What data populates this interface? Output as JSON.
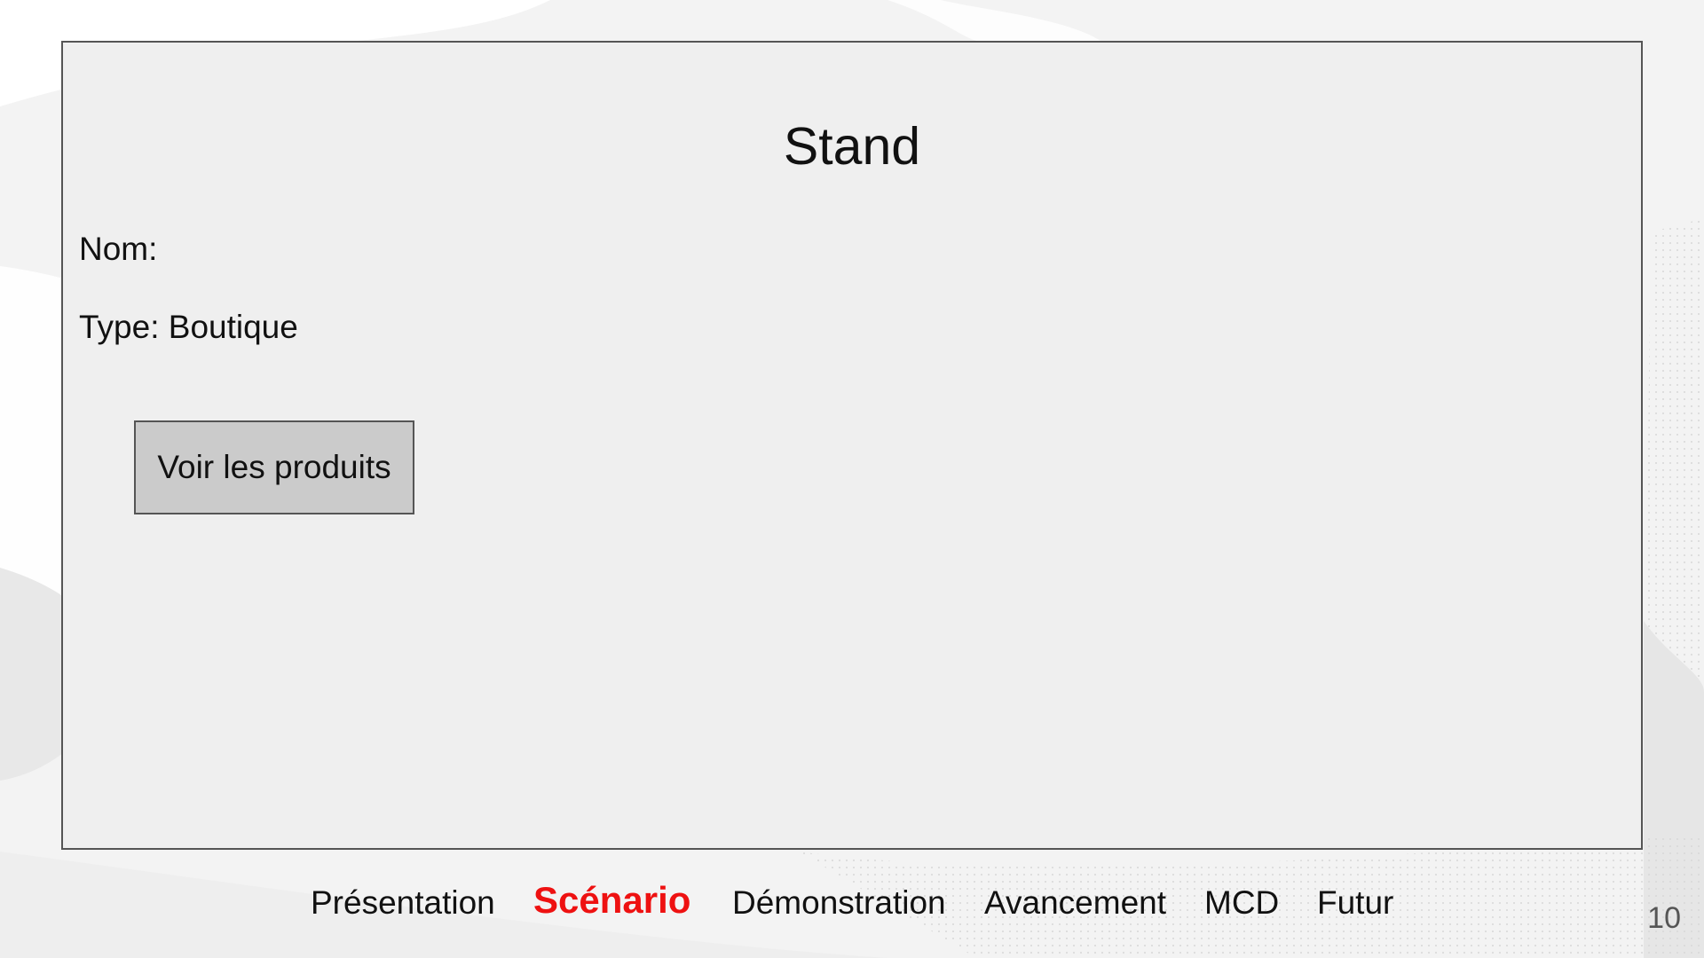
{
  "mockup": {
    "title": "Stand",
    "nom_label": "Nom:",
    "type_label": "Type: Boutique",
    "button_label": "Voir les produits"
  },
  "nav": {
    "items": [
      {
        "label": "Présentation",
        "active": false
      },
      {
        "label": "Scénario",
        "active": true
      },
      {
        "label": "Démonstration",
        "active": false
      },
      {
        "label": "Avancement",
        "active": false
      },
      {
        "label": "MCD",
        "active": false
      },
      {
        "label": "Futur",
        "active": false
      }
    ]
  },
  "page_number": "10",
  "colors": {
    "active_nav": "#ee1111",
    "mockup_bg": "#efefef",
    "button_bg": "#cbcbcb",
    "border": "#555555"
  }
}
